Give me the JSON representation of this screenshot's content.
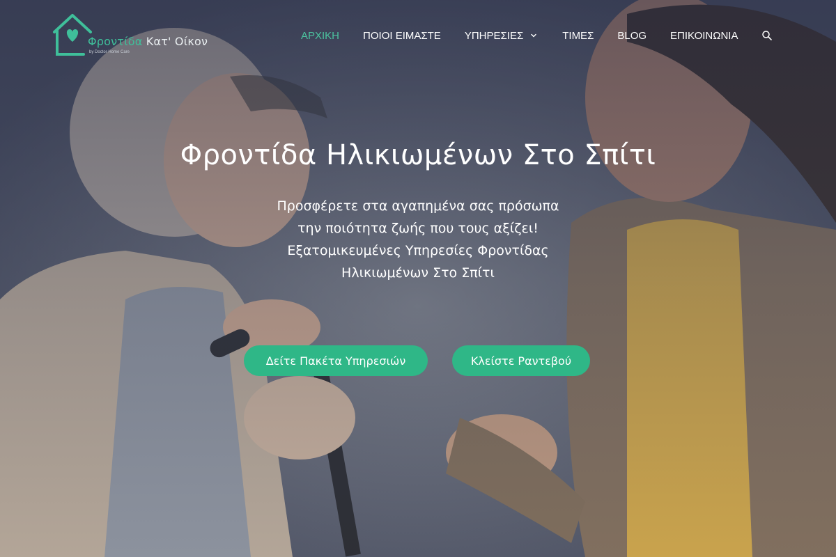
{
  "brand": {
    "name_part1": "Φροντίδα",
    "name_part2": "Κατ' Οίκον",
    "tagline": "by Doctor Home Care",
    "logo_color": "#3fbf9a"
  },
  "nav": {
    "items": [
      {
        "label": "ΑΡΧΙΚΗ",
        "active": true
      },
      {
        "label": "ΠΟΙΟΙ ΕΙΜΑΣΤΕ",
        "active": false
      },
      {
        "label": "ΥΠΗΡΕΣΙΕΣ",
        "active": false,
        "has_dropdown": true
      },
      {
        "label": "ΤΙΜΕΣ",
        "active": false
      },
      {
        "label": "BLOG",
        "active": false
      },
      {
        "label": "ΕΠΙΚΟΙΝΩΝΙΑ",
        "active": false
      }
    ],
    "search_icon": "search-icon",
    "active_color": "#4cc39f"
  },
  "hero": {
    "title": "Φροντίδα Ηλικιωμένων Στο Σπίτι",
    "subtitle_lines": [
      "Προσφέρετε στα αγαπημένα σας πρόσωπα",
      "την ποιότητα ζωής που τους αξίζει!",
      "Εξατομικευμένες Υπηρεσίες Φροντίδας",
      "Ηλικιωμένων Στο Σπίτι"
    ],
    "buttons": [
      {
        "label": "Δείτε Πακέτα Υπηρεσιών"
      },
      {
        "label": "Κλείστε Ραντεβού"
      }
    ],
    "button_color": "#2fb787"
  }
}
